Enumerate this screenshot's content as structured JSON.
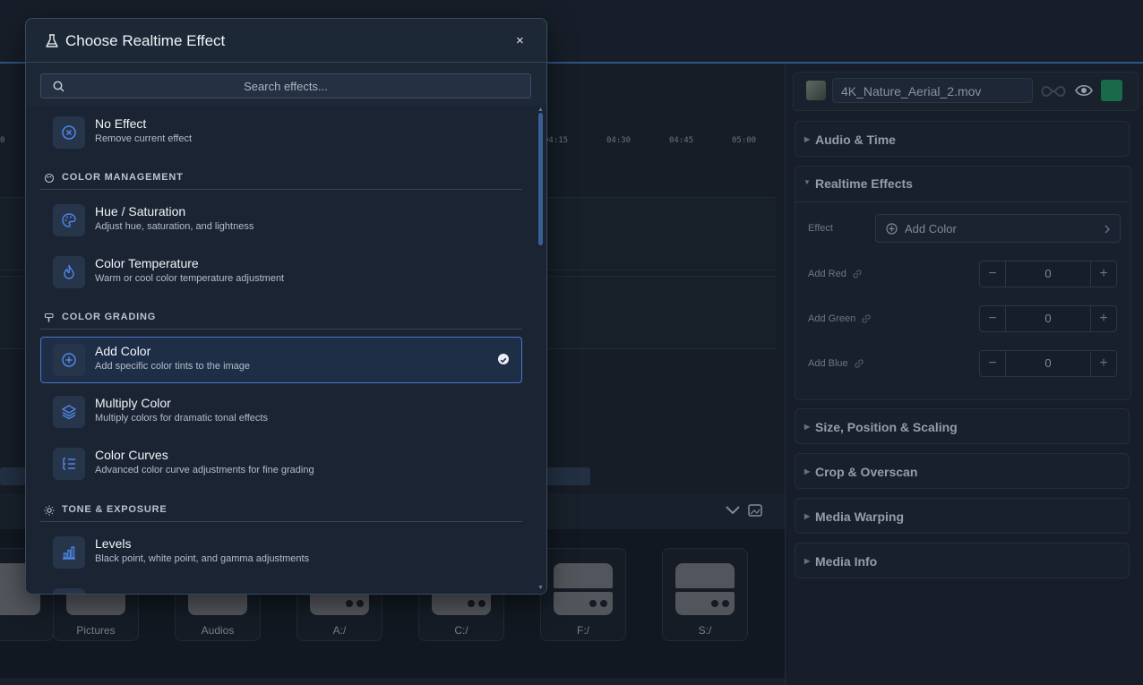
{
  "timeline": {
    "ruler": [
      "0",
      "04:15",
      "04:30",
      "04:45",
      "05:00"
    ]
  },
  "browser": {
    "tiles": [
      "Pictures",
      "Audios",
      "A:/",
      "C:/",
      "F:/",
      "S:/"
    ]
  },
  "inspector": {
    "filename": "4K_Nature_Aerial_2.mov",
    "sections": {
      "audio_time": "Audio & Time",
      "realtime_effects": "Realtime Effects",
      "size_position": "Size, Position & Scaling",
      "crop": "Crop & Overscan",
      "warping": "Media Warping",
      "info": "Media Info"
    },
    "effect_label": "Effect",
    "effect_value": "Add Color",
    "params": [
      {
        "label": "Add Red",
        "value": "0"
      },
      {
        "label": "Add Green",
        "value": "0"
      },
      {
        "label": "Add Blue",
        "value": "0"
      }
    ],
    "accent_color": "#1e8a5a"
  },
  "modal": {
    "title": "Choose Realtime Effect",
    "close": "×",
    "search_placeholder": "Search effects...",
    "no_effect": {
      "name": "No Effect",
      "desc": "Remove current effect"
    },
    "categories": {
      "color_management": "COLOR MANAGEMENT",
      "color_grading": "COLOR GRADING",
      "tone_exposure": "TONE & EXPOSURE"
    },
    "effects": {
      "hue_saturation": {
        "name": "Hue / Saturation",
        "desc": "Adjust hue, saturation, and lightness"
      },
      "color_temperature": {
        "name": "Color Temperature",
        "desc": "Warm or cool color temperature adjustment"
      },
      "add_color": {
        "name": "Add Color",
        "desc": "Add specific color tints to the image",
        "selected": true
      },
      "multiply_color": {
        "name": "Multiply Color",
        "desc": "Multiply colors for dramatic tonal effects"
      },
      "color_curves": {
        "name": "Color Curves",
        "desc": "Advanced color curve adjustments for fine grading"
      },
      "levels": {
        "name": "Levels",
        "desc": "Black point, white point, and gamma adjustments"
      }
    },
    "accent_color": "#4a78c9"
  }
}
